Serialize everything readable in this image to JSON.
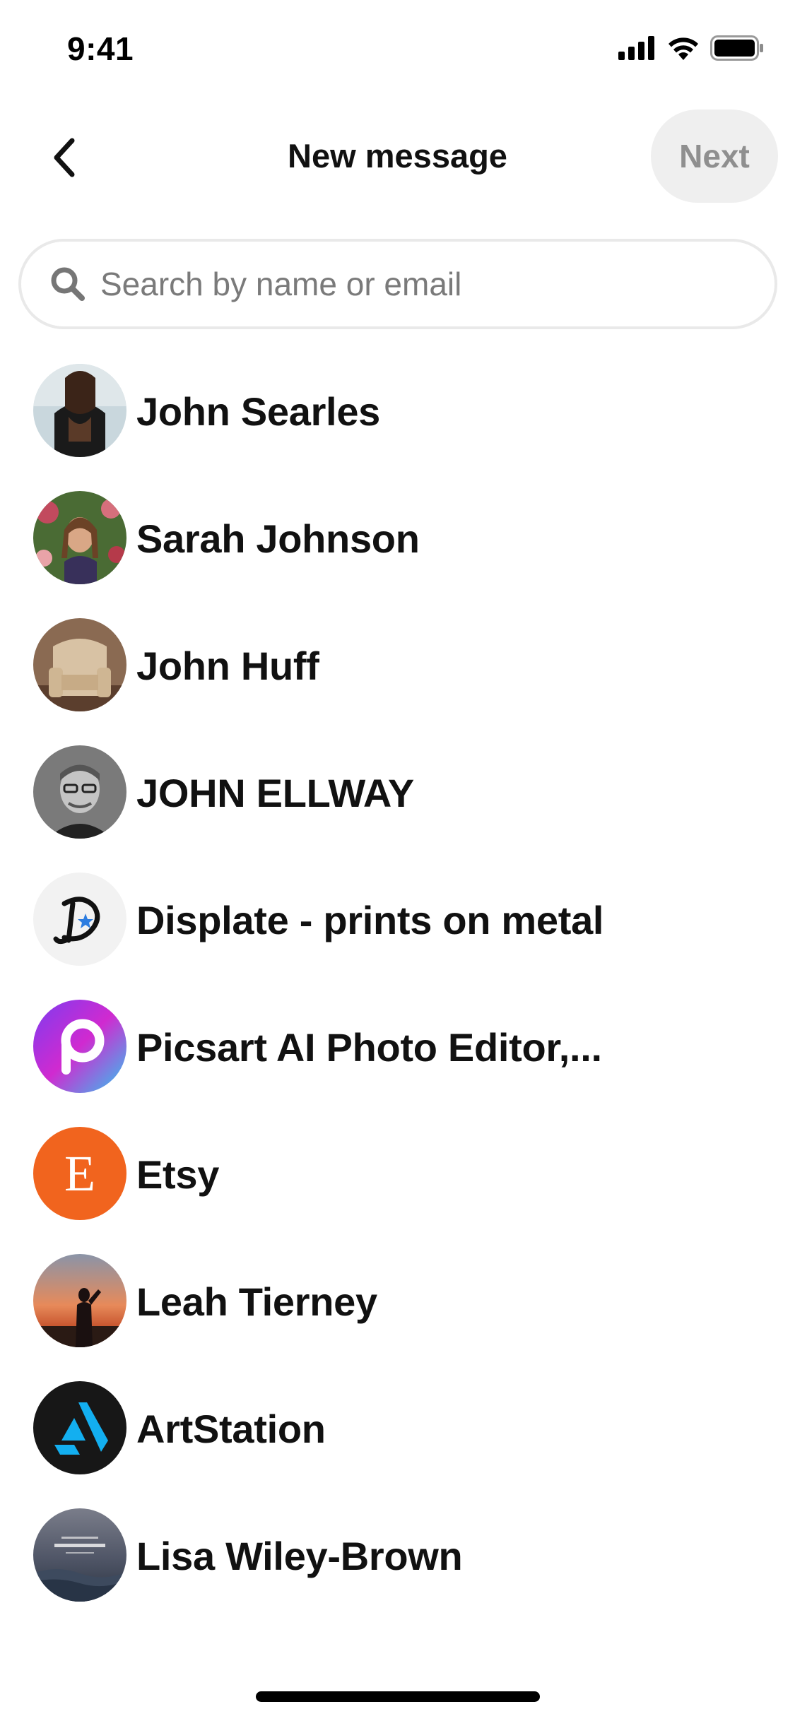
{
  "status_bar": {
    "time": "9:41"
  },
  "header": {
    "title": "New message",
    "next_label": "Next"
  },
  "search": {
    "placeholder": "Search by name or email",
    "value": ""
  },
  "contacts": [
    {
      "name": "John Searles",
      "avatar": "photo"
    },
    {
      "name": "Sarah Johnson",
      "avatar": "photo"
    },
    {
      "name": "John Huff",
      "avatar": "photo"
    },
    {
      "name": "JOHN ELLWAY",
      "avatar": "photo"
    },
    {
      "name": "Displate - prints on metal",
      "avatar": "displate-logo"
    },
    {
      "name": "Picsart AI Photo Editor,...",
      "avatar": "picsart-logo"
    },
    {
      "name": "Etsy",
      "avatar": "etsy-logo",
      "avatar_letter": "E"
    },
    {
      "name": "Leah Tierney",
      "avatar": "photo"
    },
    {
      "name": "ArtStation",
      "avatar": "artstation-logo"
    },
    {
      "name": "Lisa Wiley-Brown",
      "avatar": "photo"
    }
  ],
  "colors": {
    "etsy": "#F1641E",
    "artstation": "#13AFF0",
    "next_bg": "#EFEFEF",
    "next_text": "#8F8F8F"
  }
}
